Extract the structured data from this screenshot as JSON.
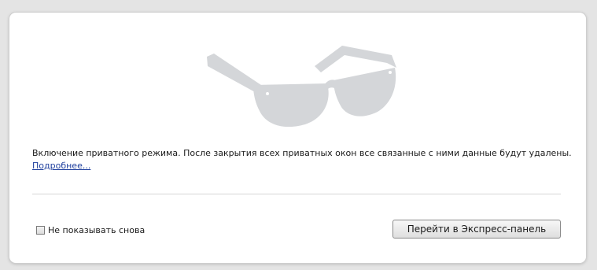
{
  "colors": {
    "background": "#e4e4e4",
    "panel": "#ffffff",
    "glasses": "#d4d6d9",
    "link": "#1f3f9e"
  },
  "hero": {
    "icon": "sunglasses-icon"
  },
  "message": {
    "text": "Включение приватного режима. После закрытия всех приватных окон все связанные с ними данные будут удалены.",
    "link_label": "Подробнее..."
  },
  "footer": {
    "checkbox_label": "Не показывать снова",
    "checkbox_checked": false,
    "button_label": "Перейти в Экспресс-панель"
  }
}
